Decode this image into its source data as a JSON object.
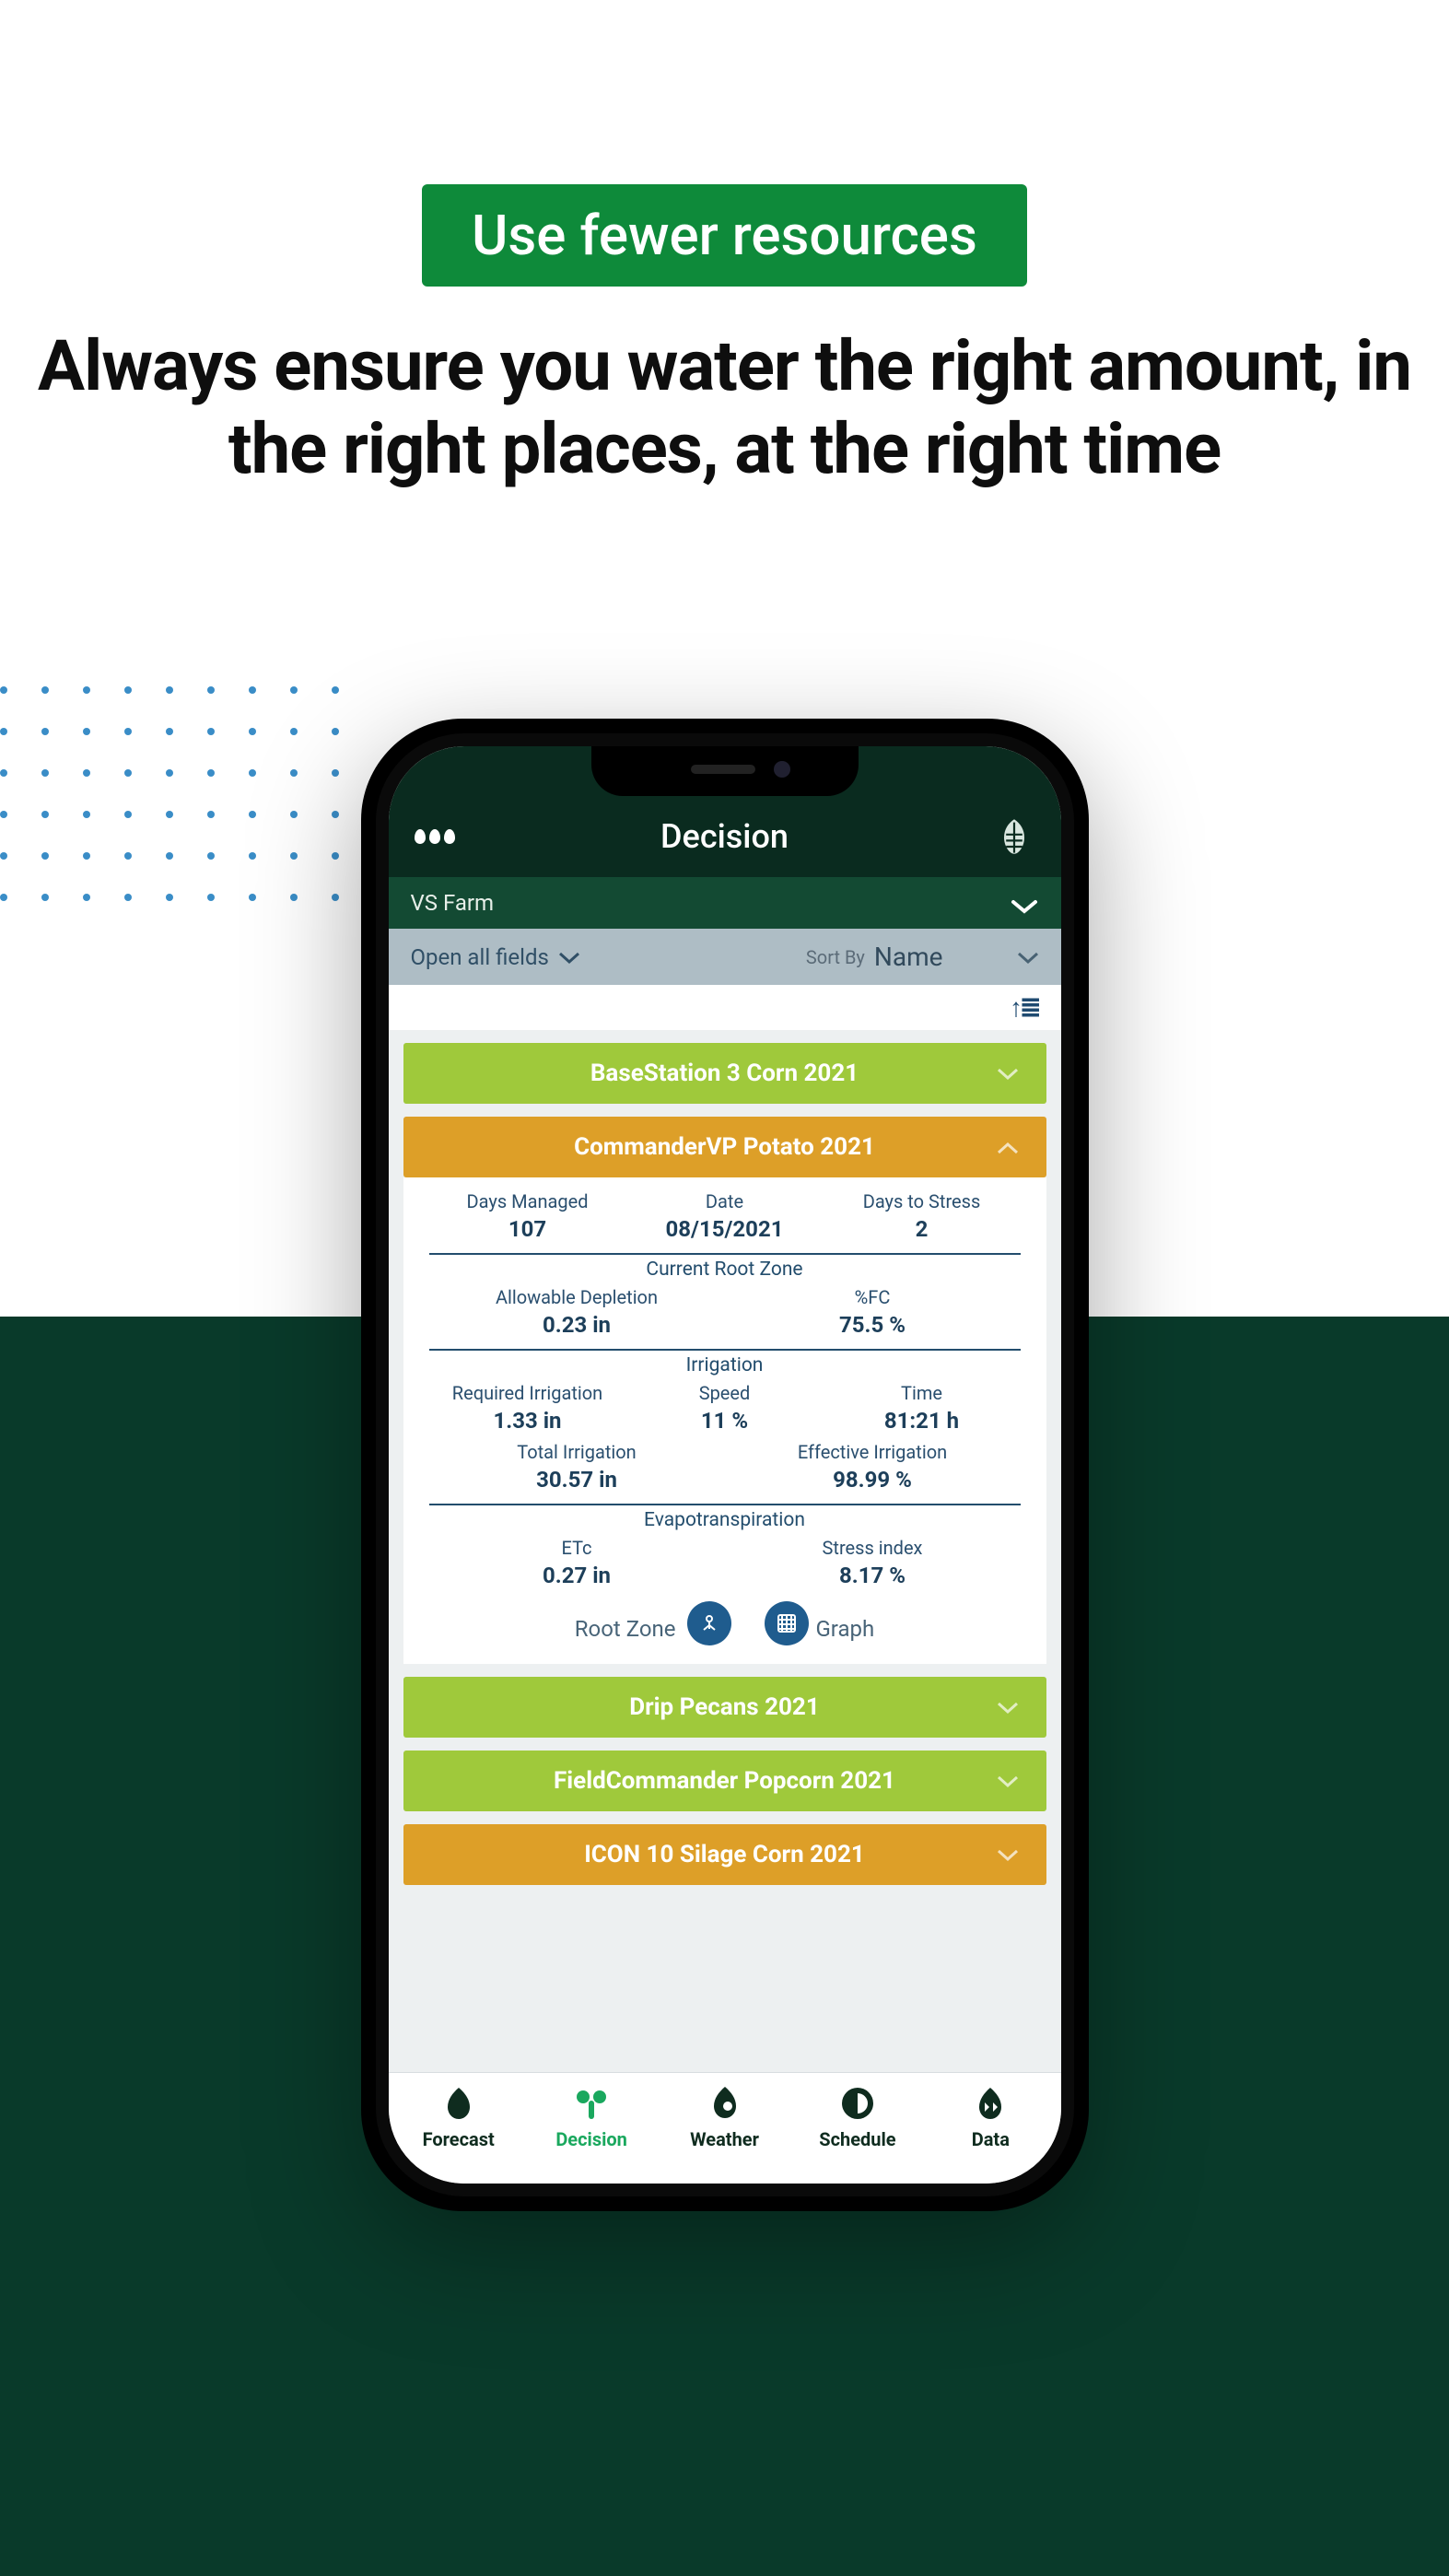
{
  "promo": {
    "badge": "Use fewer resources",
    "headline": "Always ensure you water the right amount, in the right places, at the right time"
  },
  "app": {
    "title": "Decision",
    "farm": "VS Farm",
    "open_all": "Open all fields",
    "sort_by_label": "Sort By",
    "sort_by_value": "Name",
    "sort_icons": "↑≣"
  },
  "fields": [
    {
      "label": "BaseStation 3 Corn 2021",
      "color": "green",
      "open": false
    },
    {
      "label": "CommanderVP Potato 2021",
      "color": "amber",
      "open": true
    },
    {
      "label": "Drip Pecans 2021",
      "color": "green",
      "open": false
    },
    {
      "label": "FieldCommander Popcorn 2021",
      "color": "green",
      "open": false
    },
    {
      "label": "ICON 10 Silage Corn 2021",
      "color": "amber",
      "open": false
    }
  ],
  "detail": {
    "days_managed_label": "Days Managed",
    "days_managed": "107",
    "date_label": "Date",
    "date": "08/15/2021",
    "days_to_stress_label": "Days to Stress",
    "days_to_stress": "2",
    "section_root": "Current Root Zone",
    "allowable_depletion_label": "Allowable Depletion",
    "allowable_depletion": "0.23 in",
    "fc_label": "%FC",
    "fc": "75.5 %",
    "section_irr": "Irrigation",
    "req_irr_label": "Required Irrigation",
    "req_irr": "1.33 in",
    "speed_label": "Speed",
    "speed": "11 %",
    "time_label": "Time",
    "time": "81:21 h",
    "total_irr_label": "Total Irrigation",
    "total_irr": "30.57 in",
    "eff_irr_label": "Effective Irrigation",
    "eff_irr": "98.99 %",
    "section_et": "Evapotranspiration",
    "etc_label": "ETc",
    "etc": "0.27 in",
    "stress_label": "Stress index",
    "stress": "8.17 %",
    "link_root": "Root Zone",
    "link_graph": "Graph"
  },
  "tabs": {
    "forecast": "Forecast",
    "decision": "Decision",
    "weather": "Weather",
    "schedule": "Schedule",
    "data": "Data"
  }
}
